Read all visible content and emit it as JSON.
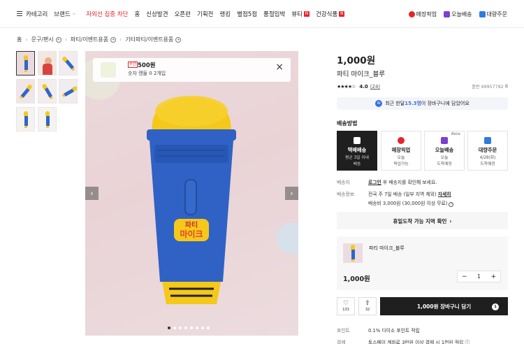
{
  "nav": {
    "category": "카테고리",
    "brand": "브랜드",
    "items": [
      "자외선 집중 차단",
      "홈",
      "신상발견",
      "오픈런",
      "기획전",
      "랭킹",
      "별점5점",
      "품절임박",
      "뷰티",
      "건강식품"
    ],
    "badge": "N",
    "right": [
      "매장픽업",
      "오늘배송",
      "대량주문"
    ]
  },
  "breadcrumb": [
    "홈",
    "문구/팬시",
    "파티/이벤트용품",
    "기타파티/이벤트용품"
  ],
  "banner": {
    "tag": "추천",
    "price": "500원",
    "name": "숫자 캔들 0 2개입"
  },
  "product": {
    "price": "1,000원",
    "name": "파티 마이크_블루",
    "stars": "★★★★☆",
    "rating": "4.0",
    "reviews": "(24)",
    "code": "품번 99957782"
  },
  "cart_notice": {
    "prefix": "최근 한달 ",
    "count": "15.3명",
    "suffix": "이 장바구니에 담았어요",
    "icon": "AI"
  },
  "shipping": {
    "title": "배송방법",
    "beta": "Beta",
    "options": [
      {
        "title": "택배배송",
        "sub1": "평균 3일 이내",
        "sub2": "배송",
        "icon": "truck-icon"
      },
      {
        "title": "매장픽업",
        "sub1": "오늘",
        "sub2": "픽업가능",
        "icon": "pickup-icon"
      },
      {
        "title": "오늘배송",
        "sub1": "오늘",
        "sub2": "도착예정",
        "icon": "today-icon"
      },
      {
        "title": "대량주문",
        "sub1": "4/28(화)",
        "sub2": "도착예정",
        "icon": "bulk-icon"
      }
    ]
  },
  "info": {
    "dest_label": "배송지",
    "login": "로그인",
    "dest_text": " 후 배송지를 확인해 보세요.",
    "ship_label": "배송정보",
    "ship_text": "전국 주 7일 배송 (일부 지역 제외) ",
    "detail": "자세히",
    "fee": "배송비 3,000원 (30,000원 이상 무료)"
  },
  "holiday_btn": "휴일도착 가능 지역 확인",
  "selected": {
    "name": "파티 마이크_블루",
    "price": "1,000원",
    "qty": "1"
  },
  "actions": {
    "like_count": "133",
    "share_count": "32",
    "cart_label": "1,000원 장바구니 담기",
    "cart_badge": "1"
  },
  "bottom": {
    "point_label": "포인트",
    "point_text": "0.1% 다이소 포인트 적립",
    "pay_label": "결제",
    "pay_text": "토스페이 계좌로 3만원 이상 결제 시 1천원 적립 ⓘ"
  },
  "colors": {
    "accent": "#e5242a",
    "dark": "#1f1f1f",
    "mic_blue": "#2f62c4",
    "mic_yellow": "#f5c819"
  }
}
